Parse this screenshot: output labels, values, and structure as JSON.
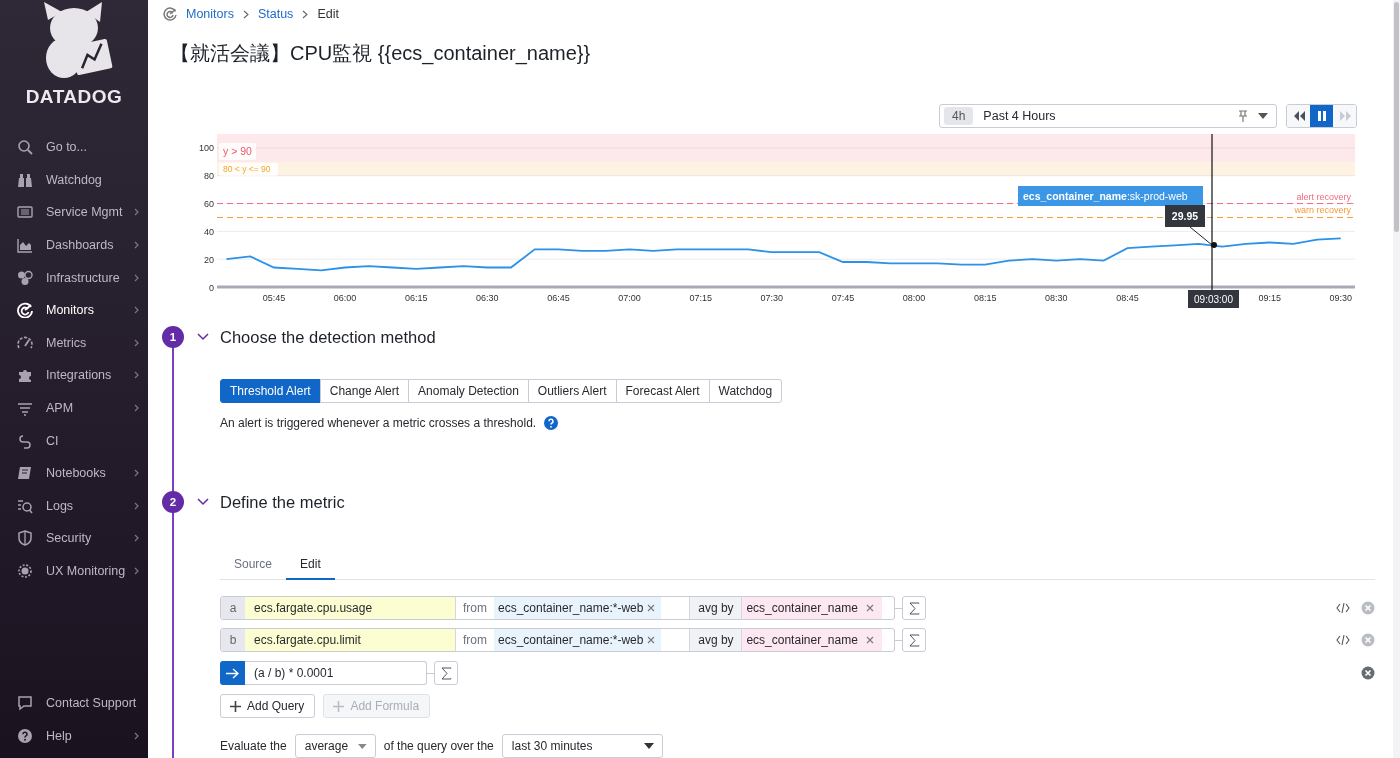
{
  "sidebar": {
    "brand": "DATADOG",
    "items": [
      {
        "label": "Go to...",
        "selected": false,
        "has_submenu": false
      },
      {
        "label": "Watchdog",
        "selected": false,
        "has_submenu": false
      },
      {
        "label": "Service Mgmt",
        "selected": false,
        "has_submenu": true
      },
      {
        "label": "Dashboards",
        "selected": false,
        "has_submenu": true
      },
      {
        "label": "Infrastructure",
        "selected": false,
        "has_submenu": true
      },
      {
        "label": "Monitors",
        "selected": true,
        "has_submenu": true
      },
      {
        "label": "Metrics",
        "selected": false,
        "has_submenu": true
      },
      {
        "label": "Integrations",
        "selected": false,
        "has_submenu": true
      },
      {
        "label": "APM",
        "selected": false,
        "has_submenu": true
      },
      {
        "label": "CI",
        "selected": false,
        "has_submenu": false
      },
      {
        "label": "Notebooks",
        "selected": false,
        "has_submenu": true
      },
      {
        "label": "Logs",
        "selected": false,
        "has_submenu": true
      },
      {
        "label": "Security",
        "selected": false,
        "has_submenu": true
      },
      {
        "label": "UX Monitoring",
        "selected": false,
        "has_submenu": true
      }
    ],
    "footer_items": [
      {
        "label": "Contact Support",
        "has_submenu": false
      },
      {
        "label": "Help",
        "has_submenu": true
      }
    ]
  },
  "breadcrumb": [
    {
      "label": "Monitors",
      "kind": "link"
    },
    {
      "label": "Status",
      "kind": "link"
    },
    {
      "label": "Edit",
      "kind": "current"
    }
  ],
  "title": "【就活会議】CPU監視 {{ecs_container_name}}",
  "time_selector": {
    "badge": "4h",
    "label": "Past 4 Hours"
  },
  "playback": [
    {
      "kind": "rewind",
      "selected": false,
      "disabled": false
    },
    {
      "kind": "pause",
      "selected": true,
      "disabled": false
    },
    {
      "kind": "forward",
      "selected": false,
      "disabled": true
    }
  ],
  "chart": {
    "tooltip": {
      "series": "**ecs_container_name**:sk-prod-web",
      "value": "29.95",
      "time": "09:03:00"
    },
    "chart_data": {
      "type": "line",
      "categories": [
        null,
        null,
        "05:45",
        null,
        null,
        "06:00",
        null,
        null,
        "06:15",
        null,
        null,
        "06:30",
        null,
        null,
        "06:45",
        null,
        null,
        "07:00",
        null,
        null,
        "07:15",
        null,
        null,
        "07:30",
        null,
        null,
        "07:45",
        null,
        null,
        "08:00",
        null,
        null,
        "08:15",
        null,
        null,
        "08:30",
        null,
        null,
        "08:45",
        null,
        null,
        null,
        null,
        null,
        "09:15",
        null,
        null,
        "09:30"
      ],
      "grid": true,
      "series": [
        {
          "color": "#2a92e8",
          "values": [
            20,
            22,
            14,
            13,
            12,
            14,
            15,
            14,
            13,
            14,
            15,
            14,
            14,
            27,
            27,
            26,
            26,
            27,
            26,
            27,
            27,
            27,
            27,
            25,
            25,
            25,
            18,
            18,
            17,
            17,
            17,
            16,
            16,
            19,
            20,
            19,
            20,
            19,
            28,
            29,
            30,
            31,
            29,
            31,
            32,
            31,
            34,
            35
          ]
        }
      ],
      "ylim": [
        0,
        110
      ],
      "yticks": [
        0,
        20,
        40,
        60,
        80,
        100
      ],
      "bands": [
        {
          "axis": "y",
          "from": 90,
          "to": 110,
          "label": "y > 90",
          "color": "#f0566a"
        },
        {
          "axis": "y",
          "from": 80,
          "to": 90,
          "label": "80 < y <= 90",
          "color": "#f5a623"
        }
      ],
      "ref_lines": [
        {
          "axis": "y",
          "value": 60,
          "label": "alert recovery",
          "color": "#f36b7f"
        },
        {
          "axis": "y",
          "value": 50,
          "label": "warn recovery",
          "color": "#f39c3c"
        }
      ]
    }
  },
  "steps": [
    {
      "number": "1",
      "title": "Choose the detection method"
    },
    {
      "number": "2",
      "title": "Define the metric"
    }
  ],
  "detection": {
    "methods": [
      {
        "label": "Threshold Alert",
        "selected": true
      },
      {
        "label": "Change Alert",
        "selected": false
      },
      {
        "label": "Anomaly Detection",
        "selected": false
      },
      {
        "label": "Outliers Alert",
        "selected": false
      },
      {
        "label": "Forecast Alert",
        "selected": false
      },
      {
        "label": "Watchdog",
        "selected": false
      }
    ],
    "description": "An alert is triggered whenever a metric crosses a threshold."
  },
  "metric": {
    "tabs": [
      {
        "label": "Source",
        "selected": false
      },
      {
        "label": "Edit",
        "selected": true
      }
    ],
    "queries": [
      {
        "letter": "a",
        "metric": "ecs.fargate.cpu.usage",
        "from_label": "from",
        "filter": "ecs_container_name:*-web",
        "aggregation": "avg by",
        "group": "ecs_container_name"
      },
      {
        "letter": "b",
        "metric": "ecs.fargate.cpu.limit",
        "from_label": "from",
        "filter": "ecs_container_name:*-web",
        "aggregation": "avg by",
        "group": "ecs_container_name"
      }
    ],
    "formula": {
      "value": "(a / b) * 0.0001"
    },
    "buttons": [
      {
        "label": "Add Query",
        "disabled": false
      },
      {
        "label": "Add Formula",
        "disabled": true
      }
    ],
    "evaluate": {
      "prefix": "Evaluate the",
      "aggregation": "average",
      "middle": "of the query over the",
      "window": "last 30 minutes"
    }
  }
}
